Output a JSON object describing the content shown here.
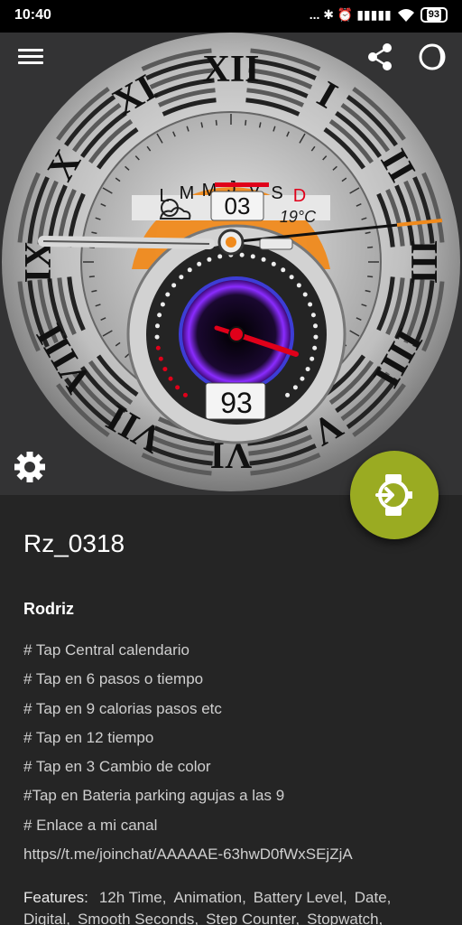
{
  "status_bar": {
    "time": "10:40",
    "icons_text": "... ✱ ⏰ ▮▮▮▮▮",
    "battery": "93"
  },
  "watch_face": {
    "roman_numerals": [
      "XII",
      "I",
      "II",
      "III",
      "IIII",
      "V",
      "VI",
      "VII",
      "VIII",
      "IX",
      "X",
      "XI"
    ],
    "weekdays": [
      "L",
      "M",
      "M",
      "J",
      "V",
      "S",
      "D"
    ],
    "date": "03",
    "temperature": "19°C",
    "battery": "93",
    "colors": {
      "orange": "#f08a1c",
      "red": "#e0001a",
      "accent": "#9aab22"
    }
  },
  "toolbar": {
    "menu_icon": "hamburger-menu-icon",
    "share_icon": "share-icon",
    "theme_icon": "theme-toggle-icon",
    "settings_icon": "gear-icon",
    "fab_icon": "watch-install-icon"
  },
  "detail": {
    "title": "Rz_0318",
    "author": "Rodriz",
    "description_lines": [
      "# Tap Central calendario",
      "# Tap en 6 pasos o tiempo",
      "# Tap en 9 calorias pasos etc",
      "# Tap en 12 tiempo",
      "# Tap en 3 Cambio de color",
      "#Tap en Bateria parking agujas a las 9",
      "# Enlace a mi canal",
      "https//t.me/joinchat/AAAAAE-63hwD0fWxSEjZjA"
    ],
    "features_label": "Features:",
    "features": [
      "12h Time,",
      "Animation,",
      "Battery Level,",
      "Date,",
      "Digital,",
      "Smooth Seconds,",
      "Step Counter,",
      "Stopwatch,"
    ]
  }
}
